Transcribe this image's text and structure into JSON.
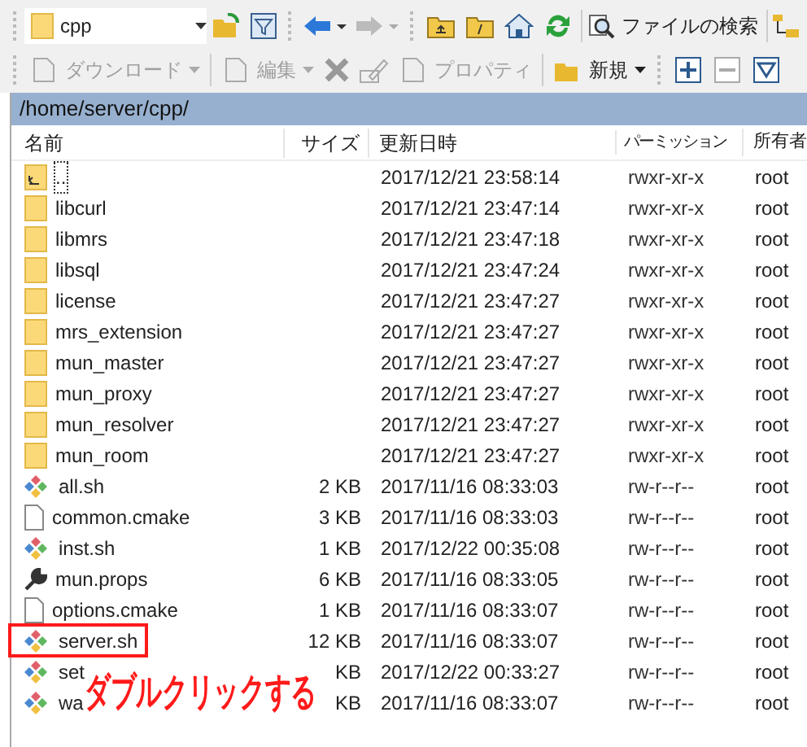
{
  "toolbar_top": {
    "location": "cpp",
    "search_button": "ファイルの検索"
  },
  "toolbar_bottom": [
    {
      "label": "ダウンロード",
      "disabled": true,
      "dropdown": true
    },
    {
      "label": "編集",
      "disabled": true,
      "dropdown": true
    },
    {
      "label": "プロパティ",
      "disabled": true,
      "dropdown": false
    },
    {
      "label": "新規",
      "disabled": false,
      "dropdown": true
    }
  ],
  "path": "/home/server/cpp/",
  "table": {
    "columns": [
      "名前",
      "サイズ",
      "更新日時",
      "パーミッション",
      "所有者"
    ],
    "rows": [
      {
        "kind": "parent",
        "name": "..",
        "size": "",
        "modified": "2017/12/21 23:58:14",
        "permissions": "rwxr-xr-x",
        "owner": "root"
      },
      {
        "kind": "folder",
        "name": "libcurl",
        "size": "",
        "modified": "2017/12/21 23:47:14",
        "permissions": "rwxr-xr-x",
        "owner": "root"
      },
      {
        "kind": "folder",
        "name": "libmrs",
        "size": "",
        "modified": "2017/12/21 23:47:18",
        "permissions": "rwxr-xr-x",
        "owner": "root"
      },
      {
        "kind": "folder",
        "name": "libsql",
        "size": "",
        "modified": "2017/12/21 23:47:24",
        "permissions": "rwxr-xr-x",
        "owner": "root"
      },
      {
        "kind": "folder",
        "name": "license",
        "size": "",
        "modified": "2017/12/21 23:47:27",
        "permissions": "rwxr-xr-x",
        "owner": "root"
      },
      {
        "kind": "folder",
        "name": "mrs_extension",
        "size": "",
        "modified": "2017/12/21 23:47:27",
        "permissions": "rwxr-xr-x",
        "owner": "root"
      },
      {
        "kind": "folder",
        "name": "mun_master",
        "size": "",
        "modified": "2017/12/21 23:47:27",
        "permissions": "rwxr-xr-x",
        "owner": "root"
      },
      {
        "kind": "folder",
        "name": "mun_proxy",
        "size": "",
        "modified": "2017/12/21 23:47:27",
        "permissions": "rwxr-xr-x",
        "owner": "root"
      },
      {
        "kind": "folder",
        "name": "mun_resolver",
        "size": "",
        "modified": "2017/12/21 23:47:27",
        "permissions": "rwxr-xr-x",
        "owner": "root"
      },
      {
        "kind": "folder",
        "name": "mun_room",
        "size": "",
        "modified": "2017/12/21 23:47:27",
        "permissions": "rwxr-xr-x",
        "owner": "root"
      },
      {
        "kind": "script",
        "name": "all.sh",
        "size": "2 KB",
        "modified": "2017/11/16 08:33:03",
        "permissions": "rw-r--r--",
        "owner": "root"
      },
      {
        "kind": "file",
        "name": "common.cmake",
        "size": "3 KB",
        "modified": "2017/11/16 08:33:03",
        "permissions": "rw-r--r--",
        "owner": "root"
      },
      {
        "kind": "script",
        "name": "inst.sh",
        "size": "1 KB",
        "modified": "2017/12/22 00:35:08",
        "permissions": "rw-r--r--",
        "owner": "root"
      },
      {
        "kind": "config",
        "name": "mun.props",
        "size": "6 KB",
        "modified": "2017/11/16 08:33:05",
        "permissions": "rw-r--r--",
        "owner": "root"
      },
      {
        "kind": "file",
        "name": "options.cmake",
        "size": "1 KB",
        "modified": "2017/11/16 08:33:07",
        "permissions": "rw-r--r--",
        "owner": "root"
      },
      {
        "kind": "script",
        "name": "server.sh",
        "size": "12 KB",
        "modified": "2017/11/16 08:33:07",
        "permissions": "rw-r--r--",
        "owner": "root",
        "highlighted": true
      },
      {
        "kind": "script",
        "name": "set",
        "size": "KB",
        "modified": "2017/12/22 00:33:27",
        "permissions": "rw-r--r--",
        "owner": "root"
      },
      {
        "kind": "script",
        "name": "wa",
        "size": "KB",
        "modified": "2017/11/16 08:33:07",
        "permissions": "rw-r--r--",
        "owner": "root"
      }
    ]
  },
  "annotation": "ダブルクリックする"
}
